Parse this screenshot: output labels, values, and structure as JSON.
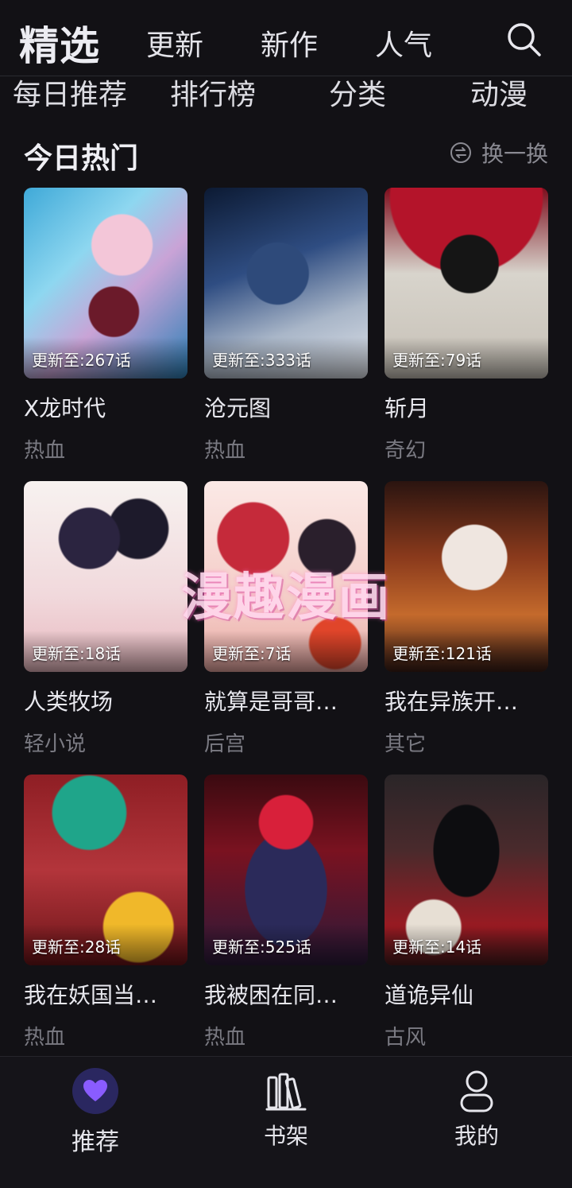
{
  "header": {
    "main_tab": "精选",
    "tabs": [
      "更新",
      "新作",
      "人气"
    ]
  },
  "subtabs": [
    "每日推荐",
    "排行榜",
    "分类",
    "动漫"
  ],
  "section": {
    "title": "今日热门",
    "refresh_label": "换一换"
  },
  "cards": [
    {
      "badge": "更新至:267话",
      "title": "X龙时代",
      "genre": "热血"
    },
    {
      "badge": "更新至:333话",
      "title": "沧元图",
      "genre": "热血"
    },
    {
      "badge": "更新至:79话",
      "title": "斩月",
      "genre": "奇幻"
    },
    {
      "badge": "更新至:18话",
      "title": "人类牧场",
      "genre": "轻小说"
    },
    {
      "badge": "更新至:7话",
      "title": "就算是哥哥…",
      "genre": "后宫"
    },
    {
      "badge": "更新至:121话",
      "title": "我在异族开…",
      "genre": "其它"
    },
    {
      "badge": "更新至:28话",
      "title": "我在妖国当…",
      "genre": "热血"
    },
    {
      "badge": "更新至:525话",
      "title": "我被困在同…",
      "genre": "热血"
    },
    {
      "badge": "更新至:14话",
      "title": "道诡异仙",
      "genre": "古风"
    }
  ],
  "watermark": "漫趣漫画",
  "bottom_nav": [
    {
      "label": "推荐",
      "icon": "heart-icon"
    },
    {
      "label": "书架",
      "icon": "bookshelf-icon"
    },
    {
      "label": "我的",
      "icon": "profile-icon"
    }
  ],
  "colors": {
    "background": "#121115",
    "accent_purple": "#7b4bff",
    "muted_text": "#7a7a82"
  }
}
